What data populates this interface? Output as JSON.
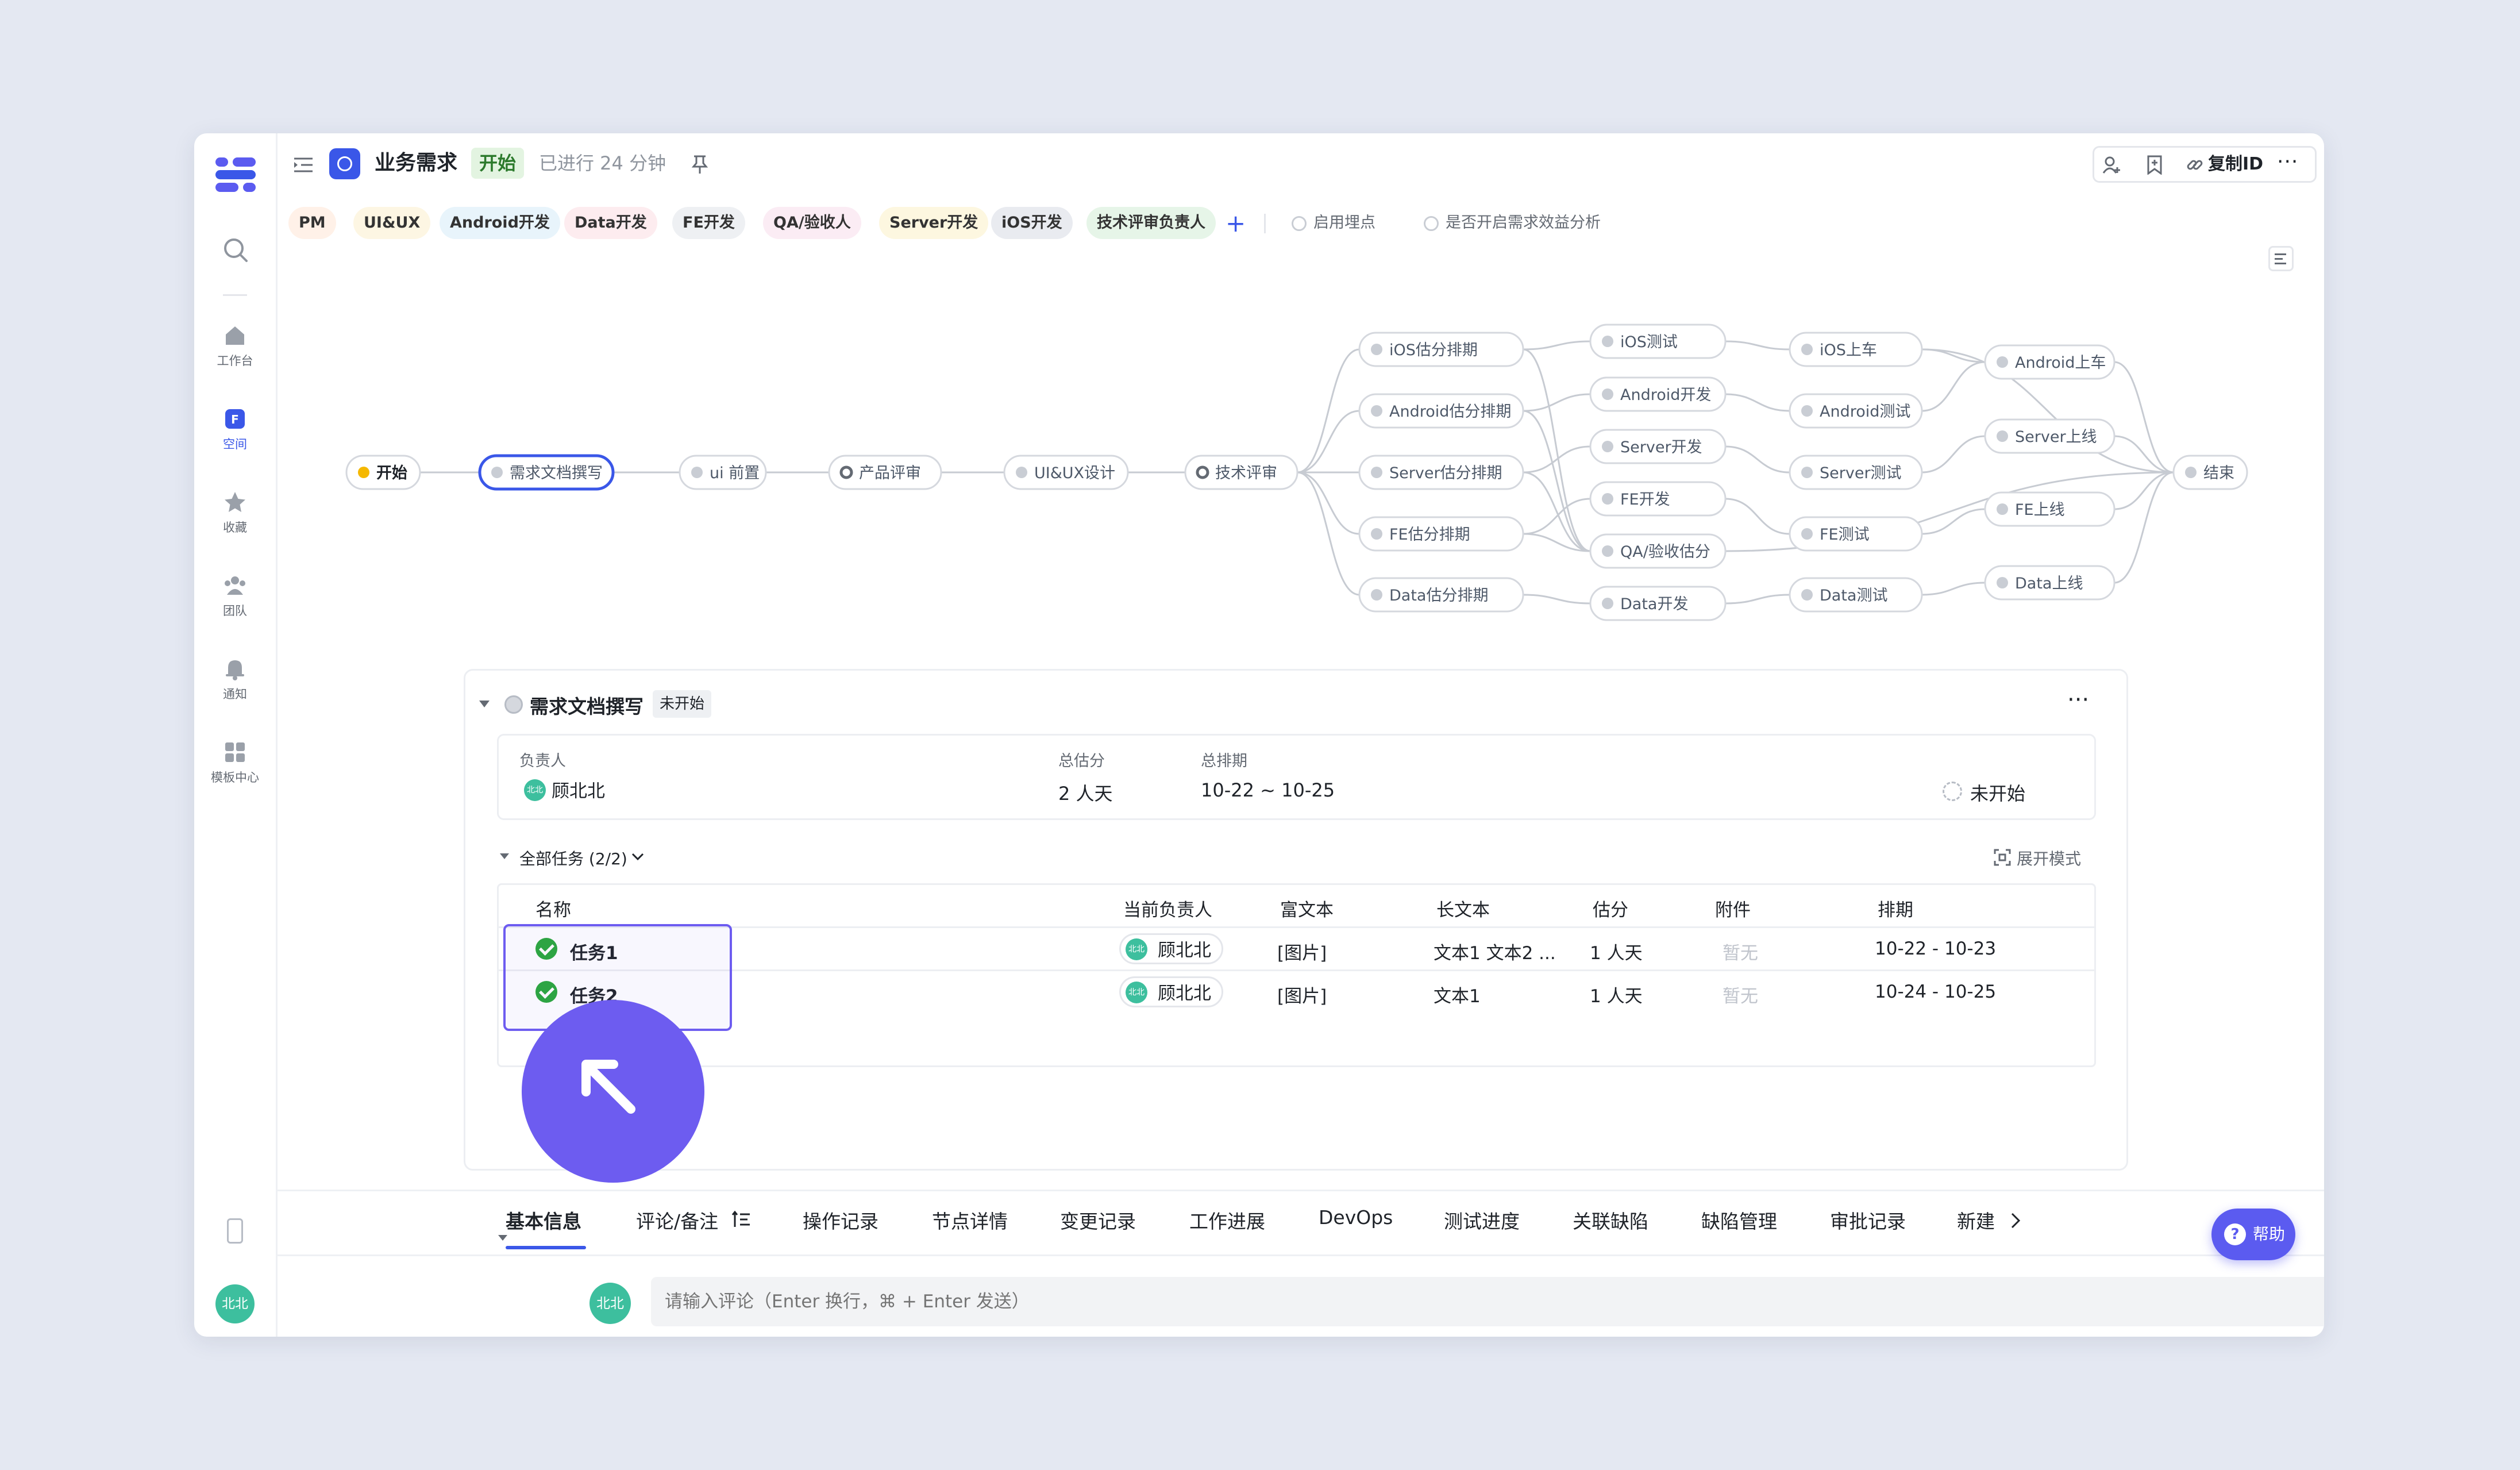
{
  "sidebar": {
    "items": [
      {
        "label": "工作台",
        "icon": "home-icon"
      },
      {
        "label": "空间",
        "icon": "space-icon"
      },
      {
        "label": "收藏",
        "icon": "star-icon"
      },
      {
        "label": "团队",
        "icon": "team-icon"
      },
      {
        "label": "通知",
        "icon": "bell-icon"
      },
      {
        "label": "模板中心",
        "icon": "template-icon"
      }
    ],
    "user_avatar": "北北"
  },
  "header": {
    "title": "业务需求",
    "status": "开始",
    "elapsed": "已进行 24 分钟",
    "copy_id": "复制ID"
  },
  "roles": [
    "PM",
    "UI&UX",
    "Android开发",
    "Data开发",
    "FE开发",
    "QA/验收人",
    "Server开发",
    "iOS开发",
    "技术评审负责人"
  ],
  "options": {
    "tracking": "启用埋点",
    "benefit_analysis": "是否开启需求效益分析"
  },
  "flow": {
    "nodes": {
      "start": "开始",
      "req_doc": "需求文档撰写",
      "ui_pre": "ui 前置",
      "product_review": "产品评审",
      "uiux_design": "UI&UX设计",
      "tech_review": "技术评审",
      "ios_est": "iOS估分排期",
      "android_est": "Android估分排期",
      "server_est": "Server估分排期",
      "fe_est": "FE估分排期",
      "data_est": "Data估分排期",
      "ios_test": "iOS测试",
      "android_dev": "Android开发",
      "server_dev": "Server开发",
      "fe_dev": "FE开发",
      "qa_est": "QA/验收估分",
      "data_dev": "Data开发",
      "ios_release": "iOS上车",
      "android_test": "Android测试",
      "server_test": "Server测试",
      "fe_test": "FE测试",
      "data_test": "Data测试",
      "android_release": "Android上车",
      "server_release": "Server上线",
      "fe_release": "FE上线",
      "data_release": "Data上线",
      "end": "结束"
    }
  },
  "node_detail": {
    "title": "需求文档撰写",
    "status": "未开始",
    "owner_label": "负责人",
    "owner": "顾北北",
    "total_est_label": "总估分",
    "total_est": "2 人天",
    "schedule_label": "总排期",
    "schedule": "10-22 ~ 10-25",
    "progress_status": "未开始"
  },
  "tasks": {
    "summary": "全部任务 (2/2)",
    "expand_mode": "展开模式",
    "columns": [
      "名称",
      "当前负责人",
      "富文本",
      "长文本",
      "估分",
      "附件",
      "排期"
    ],
    "rows": [
      {
        "name": "任务1",
        "owner": "顾北北",
        "rich_text": "[图片]",
        "long_text": "文本1 文本2 ...",
        "estimate": "1 人天",
        "attachment": "暂无",
        "schedule": "10-22 - 10-23"
      },
      {
        "name": "任务2",
        "owner": "顾北北",
        "rich_text": "[图片]",
        "long_text": "文本1",
        "estimate": "1 人天",
        "attachment": "暂无",
        "schedule": "10-24 - 10-25"
      }
    ],
    "avatar_small": "北北"
  },
  "tabs": [
    "基本信息",
    "评论/备注",
    "操作记录",
    "节点详情",
    "变更记录",
    "工作进展",
    "DevOps",
    "测试进度",
    "关联缺陷",
    "缺陷管理",
    "审批记录",
    "新建"
  ],
  "comment": {
    "avatar": "北北",
    "placeholder": "请输入评论（Enter 换行，⌘ + Enter 发送）"
  },
  "help": "帮助"
}
